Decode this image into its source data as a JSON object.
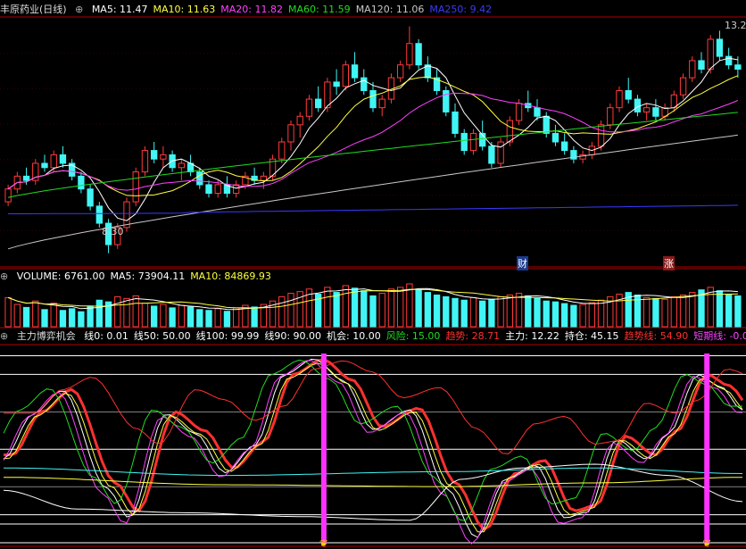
{
  "colors": {
    "background": "#000000",
    "panel_border": "#b00000",
    "up_candle": "#ff3b3b",
    "down_candle": "#41f5f5",
    "ma5": "#ffffff",
    "ma10": "#ffff40",
    "ma20": "#ff40ff",
    "ma60": "#20dd20",
    "ma120": "#c8c8c8",
    "ma250": "#3a3aff",
    "signal_bar": "#ff33ff"
  },
  "price_panel": {
    "title": "丰原药业(日线)",
    "indicators": [
      {
        "label": "MA5: 11.47",
        "color": "#ffffff"
      },
      {
        "label": "MA10: 11.63",
        "color": "#ffff40"
      },
      {
        "label": "MA20: 11.82",
        "color": "#ff40ff"
      },
      {
        "label": "MA60: 11.59",
        "color": "#20dd20"
      },
      {
        "label": "MA120: 11.06",
        "color": "#c8c8c8"
      },
      {
        "label": "MA250: 9.42",
        "color": "#3a3aff"
      }
    ],
    "high_label": "13.2",
    "low_label": "8.30",
    "event_markers": [
      "财",
      "涨"
    ]
  },
  "volume_panel": {
    "indicators": [
      {
        "label": "VOLUME: 6761.00",
        "color": "#ffffff"
      },
      {
        "label": "MA5: 73904.11",
        "color": "#ffffff"
      },
      {
        "label": "MA10: 84869.93",
        "color": "#ffff40"
      }
    ]
  },
  "indicator_panel": {
    "title": "主力博弈机会",
    "values": [
      {
        "label": "线0: 0.01",
        "color": "#ffffff"
      },
      {
        "label": "线50: 50.00",
        "color": "#ffffff"
      },
      {
        "label": "线100: 99.99",
        "color": "#ffffff"
      },
      {
        "label": "线90: 90.00",
        "color": "#ffffff"
      },
      {
        "label": "机会: 10.00",
        "color": "#ffffff"
      },
      {
        "label": "风险: 15.00",
        "color": "#20dd20"
      },
      {
        "label": "趋势: 28.71",
        "color": "#ff3030"
      },
      {
        "label": "主力: 12.22",
        "color": "#ffffff"
      },
      {
        "label": "持仓: 45.15",
        "color": "#ffffff"
      },
      {
        "label": "趋势线: 54.90",
        "color": "#ff3030"
      },
      {
        "label": "短期线: -0.0",
        "color": "#ff40ff"
      }
    ]
  },
  "chart_data": {
    "type": "line",
    "price": {
      "candles": [
        [
          9.5,
          9.9,
          9.4,
          9.8
        ],
        [
          9.8,
          10.2,
          9.7,
          10.1
        ],
        [
          10.1,
          10.3,
          9.9,
          10.0
        ],
        [
          10.0,
          10.5,
          9.9,
          10.4
        ],
        [
          10.4,
          10.6,
          10.2,
          10.3
        ],
        [
          10.3,
          10.7,
          10.2,
          10.6
        ],
        [
          10.6,
          10.8,
          10.3,
          10.4
        ],
        [
          10.4,
          10.5,
          10.0,
          10.1
        ],
        [
          10.1,
          10.2,
          9.7,
          9.8
        ],
        [
          9.8,
          9.9,
          9.3,
          9.4
        ],
        [
          9.4,
          9.5,
          8.9,
          9.0
        ],
        [
          9.0,
          9.1,
          8.3,
          8.5
        ],
        [
          8.5,
          9.0,
          8.4,
          8.9
        ],
        [
          8.9,
          9.6,
          8.8,
          9.5
        ],
        [
          9.5,
          10.3,
          9.4,
          10.2
        ],
        [
          10.2,
          10.8,
          10.1,
          10.7
        ],
        [
          10.7,
          10.9,
          10.4,
          10.5
        ],
        [
          10.5,
          10.8,
          10.3,
          10.6
        ],
        [
          10.6,
          10.7,
          10.2,
          10.3
        ],
        [
          10.3,
          10.5,
          10.0,
          10.4
        ],
        [
          10.4,
          10.6,
          10.1,
          10.2
        ],
        [
          10.2,
          10.3,
          9.8,
          9.9
        ],
        [
          9.9,
          10.0,
          9.6,
          9.7
        ],
        [
          9.7,
          10.0,
          9.6,
          9.9
        ],
        [
          9.9,
          10.1,
          9.6,
          9.7
        ],
        [
          9.7,
          10.0,
          9.6,
          9.9
        ],
        [
          9.9,
          10.2,
          9.8,
          10.1
        ],
        [
          10.1,
          10.3,
          9.9,
          10.0
        ],
        [
          10.0,
          10.2,
          9.8,
          10.1
        ],
        [
          10.1,
          10.6,
          10.0,
          10.5
        ],
        [
          10.5,
          11.0,
          10.4,
          10.9
        ],
        [
          10.9,
          11.4,
          10.7,
          11.3
        ],
        [
          11.3,
          11.6,
          11.0,
          11.5
        ],
        [
          11.5,
          12.0,
          11.4,
          11.9
        ],
        [
          11.9,
          12.2,
          11.6,
          11.7
        ],
        [
          11.7,
          12.4,
          11.6,
          12.3
        ],
        [
          12.3,
          12.6,
          12.0,
          12.2
        ],
        [
          12.2,
          12.8,
          12.1,
          12.7
        ],
        [
          12.7,
          13.0,
          12.3,
          12.4
        ],
        [
          12.4,
          12.6,
          12.0,
          12.1
        ],
        [
          12.1,
          12.3,
          11.6,
          11.7
        ],
        [
          11.7,
          12.0,
          11.5,
          11.9
        ],
        [
          11.9,
          12.5,
          11.8,
          12.4
        ],
        [
          12.4,
          12.8,
          12.3,
          12.7
        ],
        [
          12.7,
          13.6,
          12.6,
          13.2
        ],
        [
          13.2,
          13.3,
          12.6,
          12.7
        ],
        [
          12.7,
          12.9,
          12.3,
          12.4
        ],
        [
          12.4,
          12.6,
          12.0,
          12.1
        ],
        [
          12.1,
          12.2,
          11.5,
          11.6
        ],
        [
          11.6,
          11.8,
          11.0,
          11.1
        ],
        [
          11.1,
          11.2,
          10.6,
          10.7
        ],
        [
          10.7,
          11.2,
          10.6,
          11.1
        ],
        [
          11.1,
          11.4,
          10.7,
          10.8
        ],
        [
          10.8,
          10.9,
          10.3,
          10.4
        ],
        [
          10.4,
          11.0,
          10.3,
          10.9
        ],
        [
          10.9,
          11.5,
          10.8,
          11.4
        ],
        [
          11.4,
          11.9,
          11.3,
          11.8
        ],
        [
          11.8,
          12.1,
          11.6,
          11.7
        ],
        [
          11.7,
          11.9,
          11.4,
          11.5
        ],
        [
          11.5,
          11.6,
          11.0,
          11.1
        ],
        [
          11.1,
          11.3,
          10.8,
          10.9
        ],
        [
          10.9,
          11.1,
          10.6,
          10.7
        ],
        [
          10.7,
          10.8,
          10.4,
          10.5
        ],
        [
          10.5,
          10.7,
          10.4,
          10.6
        ],
        [
          10.6,
          10.9,
          10.5,
          10.8
        ],
        [
          10.8,
          11.4,
          10.7,
          11.3
        ],
        [
          11.3,
          11.8,
          11.2,
          11.7
        ],
        [
          11.7,
          12.2,
          11.6,
          12.1
        ],
        [
          12.1,
          12.4,
          11.8,
          11.9
        ],
        [
          11.9,
          12.0,
          11.5,
          11.6
        ],
        [
          11.6,
          11.8,
          11.4,
          11.7
        ],
        [
          11.7,
          11.9,
          11.4,
          11.5
        ],
        [
          11.5,
          11.8,
          11.4,
          11.7
        ],
        [
          11.7,
          12.1,
          11.6,
          12.0
        ],
        [
          12.0,
          12.5,
          11.9,
          12.4
        ],
        [
          12.4,
          12.9,
          12.3,
          12.8
        ],
        [
          12.8,
          13.0,
          12.5,
          12.6
        ],
        [
          12.6,
          13.4,
          12.5,
          13.3
        ],
        [
          13.3,
          13.5,
          12.8,
          12.9
        ],
        [
          12.9,
          13.1,
          12.6,
          12.7
        ],
        [
          12.7,
          12.9,
          12.4,
          12.6
        ]
      ],
      "ma_periods": [
        5,
        10,
        20,
        60,
        120,
        250
      ],
      "ma_end_values": [
        11.47,
        11.63,
        11.82,
        11.59,
        11.06,
        9.42
      ],
      "ylim": [
        8.0,
        13.8
      ]
    },
    "volume": {
      "values": [
        68,
        52,
        45,
        60,
        40,
        55,
        38,
        42,
        35,
        48,
        62,
        58,
        70,
        66,
        72,
        55,
        48,
        52,
        44,
        50,
        46,
        40,
        38,
        42,
        36,
        44,
        50,
        46,
        52,
        60,
        70,
        78,
        82,
        88,
        76,
        92,
        80,
        96,
        90,
        84,
        72,
        78,
        88,
        92,
        100,
        86,
        80,
        74,
        70,
        66,
        62,
        68,
        60,
        64,
        70,
        74,
        78,
        72,
        66,
        60,
        58,
        54,
        50,
        52,
        56,
        62,
        70,
        76,
        80,
        74,
        68,
        66,
        64,
        70,
        74,
        80,
        86,
        92,
        84,
        76,
        72
      ],
      "ma5_end": 73904.11,
      "ma10_end": 84869.93,
      "last": 6761.0
    },
    "oscillator": {
      "ylim": [
        0,
        100
      ],
      "reference_lines": [
        0.01,
        10,
        15,
        50,
        90,
        99.99
      ],
      "signal_bars_at": [
        35,
        77
      ],
      "series_end": {
        "趋势": 28.71,
        "主力": 12.22,
        "持仓": 45.15,
        "趋势线": 54.9,
        "短期线": -0.0
      }
    }
  }
}
